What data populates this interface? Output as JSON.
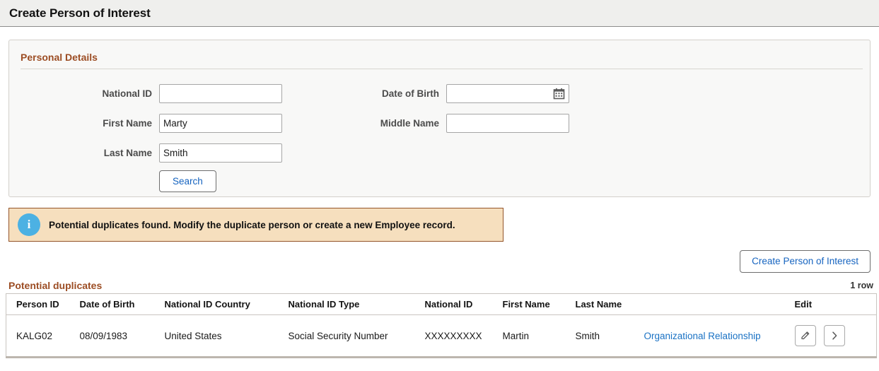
{
  "header": {
    "title": "Create Person of Interest"
  },
  "personal_details": {
    "group_title": "Personal Details",
    "fields": {
      "national_id": {
        "label": "National ID",
        "value": "",
        "placeholder": ""
      },
      "first_name": {
        "label": "First Name",
        "value": "Marty",
        "placeholder": ""
      },
      "last_name": {
        "label": "Last Name",
        "value": "Smith",
        "placeholder": ""
      },
      "date_of_birth": {
        "label": "Date of Birth",
        "value": "",
        "placeholder": "",
        "icon": "calendar-icon"
      },
      "middle_name": {
        "label": "Middle Name",
        "value": "",
        "placeholder": ""
      }
    },
    "search_button": "Search"
  },
  "message": {
    "icon": "info-icon",
    "icon_glyph": "i",
    "text": "Potential duplicates found. Modify the duplicate person or create a new Employee record.",
    "background_color": "#f6dfbe",
    "border_color": "#94552a",
    "icon_color": "#4cb1e3"
  },
  "actions": {
    "create_person_of_interest": "Create Person of Interest"
  },
  "grid": {
    "caption": "Potential duplicates",
    "row_count_label": "1 row",
    "columns": [
      "Person ID",
      "Date of Birth",
      "National ID Country",
      "National ID Type",
      "National ID",
      "First Name",
      "Last Name",
      "",
      "Edit"
    ],
    "rows": [
      {
        "person_id": "KALG02",
        "date_of_birth": "08/09/1983",
        "national_id_country": "United States",
        "national_id_type": "Social Security Number",
        "national_id": "XXXXXXXXX",
        "first_name": "Martin",
        "last_name": "Smith",
        "relationship_link": "Organizational Relationship",
        "edit_icon": "pencil-icon",
        "forward_icon": "chevron-right-icon"
      }
    ]
  },
  "colors": {
    "accent_heading": "#9c4d24",
    "link": "#1a72c4",
    "button_text": "#1664c0",
    "header_bg": "#efefed"
  }
}
